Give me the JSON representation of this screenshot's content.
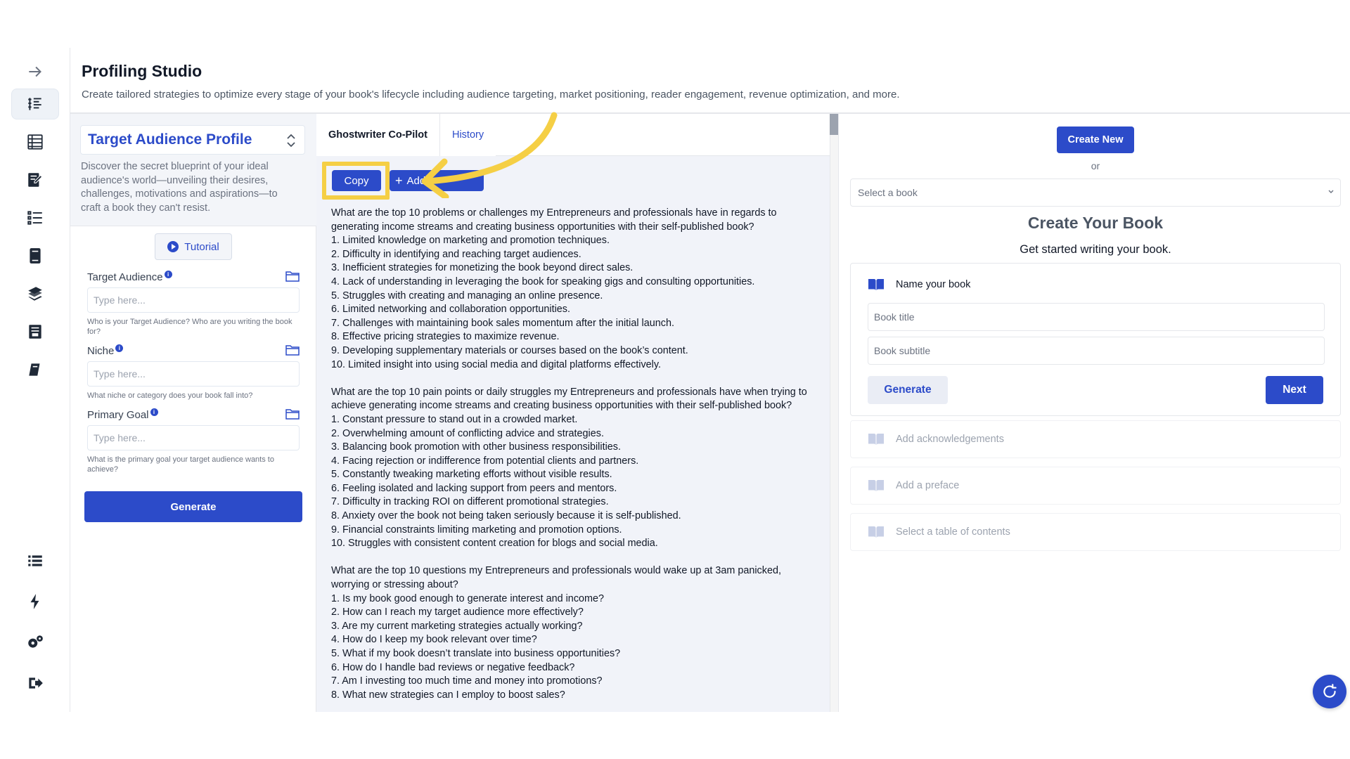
{
  "header": {
    "title": "Profiling Studio",
    "description": "Create tailored strategies to optimize every stage of your book's lifecycle including audience targeting, market positioning, reader engagement, revenue optimization, and more."
  },
  "rail": {
    "icons": [
      "expand-arrow-icon",
      "profiling-list-icon",
      "table-book-icon",
      "book-edit-icon",
      "numbered-list-icon",
      "book-stack-icon",
      "books-icon",
      "archive-icon",
      "book-icon",
      "list-icon",
      "bolt-icon",
      "settings-icon",
      "logout-icon"
    ]
  },
  "profile": {
    "selected": "Target Audience Profile",
    "description": "Discover the secret blueprint of your ideal audience's world—unveiling their desires, challenges, motivations and aspirations—to craft a book they can't resist.",
    "tutorial_label": "Tutorial",
    "fields": [
      {
        "label": "Target Audience",
        "placeholder": "Type here...",
        "help": "Who is your Target Audience? Who are you writing the book for?"
      },
      {
        "label": "Niche",
        "placeholder": "Type here...",
        "help": "What niche or category does your book fall into?"
      },
      {
        "label": "Primary Goal",
        "placeholder": "Type here...",
        "help": "What is the primary goal your target audience wants to achieve?"
      }
    ],
    "generate_label": "Generate"
  },
  "copilot": {
    "tabs": [
      "Ghostwriter Co-Pilot",
      "History"
    ],
    "copy_label": "Copy",
    "add_label": "Add",
    "output": "What are the top 10 problems or challenges my Entrepreneurs and professionals have in regards to generating income streams and creating business opportunities with their self-published book?\n1. Limited knowledge on marketing and promotion techniques.\n2. Difficulty in identifying and reaching target audiences.\n3. Inefficient strategies for monetizing the book beyond direct sales.\n4. Lack of understanding in leveraging the book for speaking gigs and consulting opportunities.\n5. Struggles with creating and managing an online presence.\n6. Limited networking and collaboration opportunities.\n7. Challenges with maintaining book sales momentum after the initial launch.\n8. Effective pricing strategies to maximize revenue.\n9. Developing supplementary materials or courses based on the book’s content.\n10. Limited insight into using social media and digital platforms effectively.\n\nWhat are the top 10 pain points or daily struggles my Entrepreneurs and professionals have when trying to achieve generating income streams and creating business opportunities with their self-published book?\n1. Constant pressure to stand out in a crowded market.\n2. Overwhelming amount of conflicting advice and strategies.\n3. Balancing book promotion with other business responsibilities.\n4. Facing rejection or indifference from potential clients and partners.\n5. Constantly tweaking marketing efforts without visible results.\n6. Feeling isolated and lacking support from peers and mentors.\n7. Difficulty in tracking ROI on different promotional strategies.\n8. Anxiety over the book not being taken seriously because it is self-published.\n9. Financial constraints limiting marketing and promotion options.\n10. Struggles with consistent content creation for blogs and social media.\n\nWhat are the top 10 questions my Entrepreneurs and professionals would wake up at 3am panicked, worrying or stressing about?\n1. Is my book good enough to generate interest and income?\n2. How can I reach my target audience more effectively?\n3. Are my current marketing strategies actually working?\n4. How do I keep my book relevant over time?\n5. What if my book doesn’t translate into business opportunities?\n6. How do I handle bad reviews or negative feedback?\n7. Am I investing too much time and money into promotions?\n8. What new strategies can I employ to boost sales?"
  },
  "book": {
    "create_new_label": "Create New",
    "or_label": "or",
    "select_placeholder": "Select a book",
    "title": "Create Your Book",
    "subtitle": "Get started writing your book.",
    "name_step": "Name your book",
    "title_placeholder": "Book title",
    "subtitle_placeholder": "Book subtitle",
    "generate_label": "Generate",
    "next_label": "Next",
    "steps": [
      "Add acknowledgements",
      "Add a preface",
      "Select a table of contents"
    ]
  },
  "colors": {
    "accent": "#2c4bc9",
    "highlight": "#f5cf45"
  }
}
